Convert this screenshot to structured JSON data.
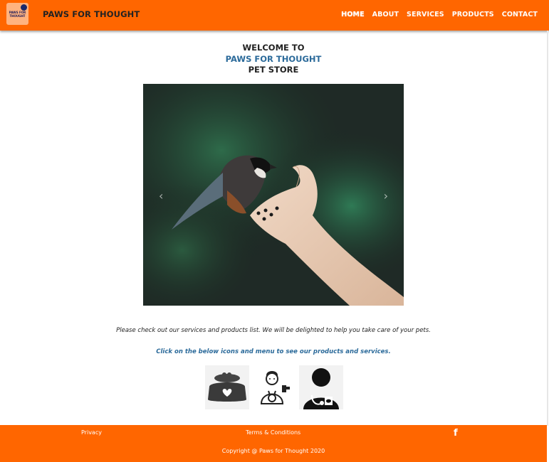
{
  "brand": {
    "logo_text": "Paws for Thought",
    "name": "PAWS FOR THOUGHT"
  },
  "nav": {
    "items": [
      {
        "label": "HOME",
        "active": true
      },
      {
        "label": "ABOUT"
      },
      {
        "label": "SERVICES"
      },
      {
        "label": "PRODUCTS"
      },
      {
        "label": "CONTACT"
      }
    ]
  },
  "hero": {
    "line1": "WELCOME TO",
    "line2": "PAWS FOR THOUGHT",
    "line3": "PET STORE"
  },
  "carousel": {
    "prev_icon": "‹",
    "next_icon": "›"
  },
  "main": {
    "intro": "Please check out our services and products list. We will be delighted to help you take care of your pets.",
    "cta": "Click on the below icons and menu to see our products and services."
  },
  "icons": [
    {
      "name": "pet-food-bowl-icon"
    },
    {
      "name": "pet-groomer-icon"
    },
    {
      "name": "veterinarian-icon"
    }
  ],
  "footer": {
    "privacy": "Privacy",
    "terms": "Terms & Conditions",
    "facebook": "f",
    "copyright": "Copyright @ Paws for Thought 2020"
  },
  "colors": {
    "brand_orange": "#ff6600",
    "accent_blue": "#2b6a9a"
  }
}
